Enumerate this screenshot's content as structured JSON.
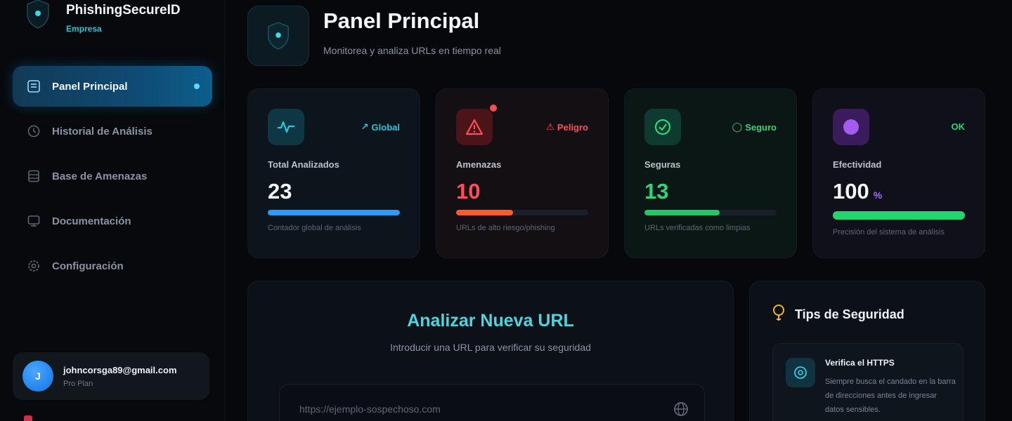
{
  "brand": {
    "name": "PhishingSecureID",
    "subtitle": "Empresa"
  },
  "sidebar": {
    "items": [
      {
        "label": "Panel Principal",
        "icon": "dashboard-icon",
        "active": true
      },
      {
        "label": "Historial de Análisis",
        "icon": "history-icon",
        "active": false
      },
      {
        "label": "Base de Amenazas",
        "icon": "database-icon",
        "active": false
      },
      {
        "label": "Documentación",
        "icon": "monitor-icon",
        "active": false
      },
      {
        "label": "Configuración",
        "icon": "gear-icon",
        "active": false
      }
    ]
  },
  "user": {
    "initial": "J",
    "email": "johncorsga89@gmail.com",
    "plan": "Pro Plan"
  },
  "header": {
    "title": "Panel Principal",
    "subtitle": "Monitorea y analiza URLs en tiempo real"
  },
  "stats": [
    {
      "label": "Total Analizados",
      "value": "23",
      "badge": "Global",
      "description": "Contador global de análisis",
      "progress": 1.0,
      "color": "#2b9bff",
      "icon": "activity-icon"
    },
    {
      "label": "Amenazas",
      "value": "10",
      "badge": "Peligro",
      "description": "URLs de alto riesgo/phishing",
      "progress": 0.43,
      "color": "#ff5a2c",
      "icon": "warning-icon"
    },
    {
      "label": "Seguras",
      "value": "13",
      "badge": "Seguro",
      "description": "URLs verificadas como limpias",
      "progress": 0.57,
      "color": "#22c768",
      "icon": "check-circle-icon"
    },
    {
      "label": "Efectividad",
      "value": "100",
      "unit": "%",
      "badge": "OK",
      "description": "Precisión del sistema de análisis",
      "progress": 1.0,
      "color": "#22d66e",
      "icon": "purple-dot-icon"
    }
  ],
  "analyze": {
    "title": "Analizar Nueva URL",
    "subtitle": "Introducir una URL para verificar su seguridad",
    "placeholder": "https://ejemplo-sospechoso.com"
  },
  "tips": {
    "title": "Tips de Seguridad",
    "items": [
      {
        "title": "Verifica el HTTPS",
        "text": "Siempre busca el candado en la barra de direcciones antes de ingresar datos sensibles."
      }
    ]
  },
  "colors": {
    "accent": "#22c7d6",
    "danger": "#ff4d5a",
    "success": "#2bd67b",
    "purple": "#a46cff"
  }
}
